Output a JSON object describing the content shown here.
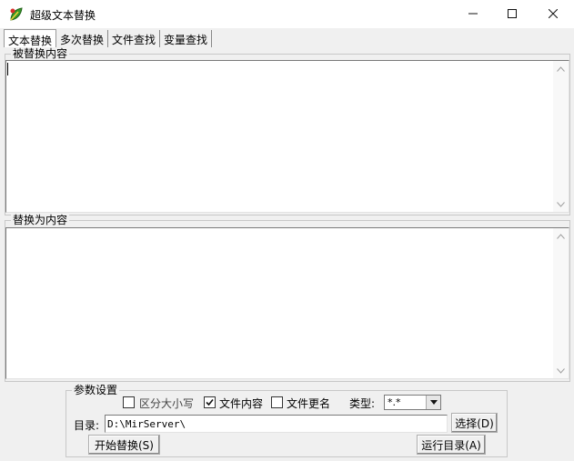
{
  "window": {
    "title": "超级文本替换"
  },
  "tabs": [
    {
      "label": "文本替换",
      "active": true
    },
    {
      "label": "多次替换",
      "active": false
    },
    {
      "label": "文件查找",
      "active": false
    },
    {
      "label": "变量查找",
      "active": false
    }
  ],
  "source_group": {
    "label": "被替换内容",
    "value": ""
  },
  "replace_group": {
    "label": "替换为内容",
    "value": ""
  },
  "params": {
    "label": "参数设置",
    "case_sensitive": {
      "label": "区分大小写",
      "checked": false
    },
    "file_content": {
      "label": "文件内容",
      "checked": true
    },
    "file_rename": {
      "label": "文件更名",
      "checked": false
    },
    "type_label": "类型:",
    "type_value": "*.*",
    "dir_label": "目录:",
    "dir_value": "D:\\MirServer\\",
    "select_button": "选择(D)",
    "start_button": "开始替换(S)",
    "run_dir_button": "运行目录(A)"
  },
  "icons": {
    "app": "app-leaf-icon",
    "minimize": "minimize-icon",
    "maximize": "maximize-icon",
    "close": "close-icon"
  }
}
